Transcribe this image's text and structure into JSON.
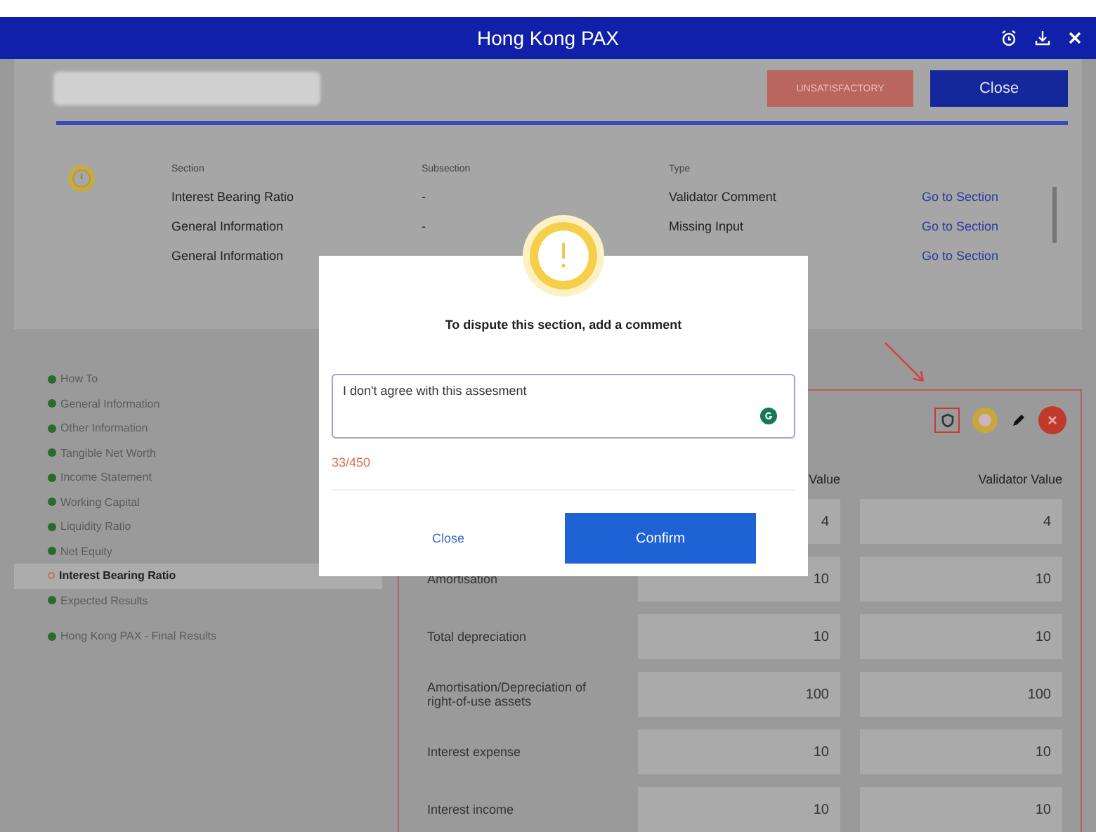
{
  "window": {
    "title": "Hong Kong PAX"
  },
  "header": {
    "status_button": "UNSATISFACTORY",
    "close_button": "Close"
  },
  "issues": {
    "columns": [
      "Section",
      "Subsection",
      "Type"
    ],
    "rows": [
      {
        "section": "Interest Bearing Ratio",
        "subsection": "-",
        "type": "Validator Comment",
        "link": "Go to Section"
      },
      {
        "section": "General Information",
        "subsection": "-",
        "type": "Missing Input",
        "link": "Go to Section"
      },
      {
        "section": "General Information",
        "link": "Go to Section"
      }
    ]
  },
  "sidebar": {
    "items": [
      {
        "label": "How To",
        "done": true,
        "selected": false
      },
      {
        "label": "General Information",
        "done": true,
        "selected": false
      },
      {
        "label": "Other Information",
        "done": true,
        "selected": false
      },
      {
        "label": "Tangible Net Worth",
        "done": true,
        "selected": false
      },
      {
        "label": "Income Statement",
        "done": true,
        "selected": false
      },
      {
        "label": "Working Capital",
        "done": true,
        "selected": false
      },
      {
        "label": "Liquidity Ratio",
        "done": true,
        "selected": false
      },
      {
        "label": "Net Equity",
        "done": true,
        "selected": false
      },
      {
        "label": "Interest Bearing Ratio",
        "done": false,
        "selected": true
      },
      {
        "label": "Expected Results",
        "done": true,
        "selected": false
      }
    ],
    "footer_item": {
      "label": "Hong Kong PAX - Final Results",
      "done": true,
      "selected": false
    }
  },
  "panel": {
    "columns": [
      "Value",
      "Validator Value"
    ],
    "rows": [
      {
        "values": [
          "4",
          "4"
        ]
      },
      {
        "label": "Amortisation",
        "values": [
          "10",
          "10"
        ]
      },
      {
        "label": "Total depreciation",
        "values": [
          "10",
          "10"
        ]
      },
      {
        "label": "Amortisation/Depreciation of right-of-use assets",
        "values": [
          "100",
          "100"
        ]
      },
      {
        "label": "Interest expense",
        "values": [
          "10",
          "10"
        ]
      },
      {
        "label": "Interest income",
        "values": [
          "10",
          "10"
        ]
      }
    ]
  },
  "dialog": {
    "title": "To dispute this section, add a comment",
    "comment": "I don't agree with this assesment",
    "counter": "33/450",
    "buttons": [
      "Close",
      "Confirm"
    ]
  }
}
